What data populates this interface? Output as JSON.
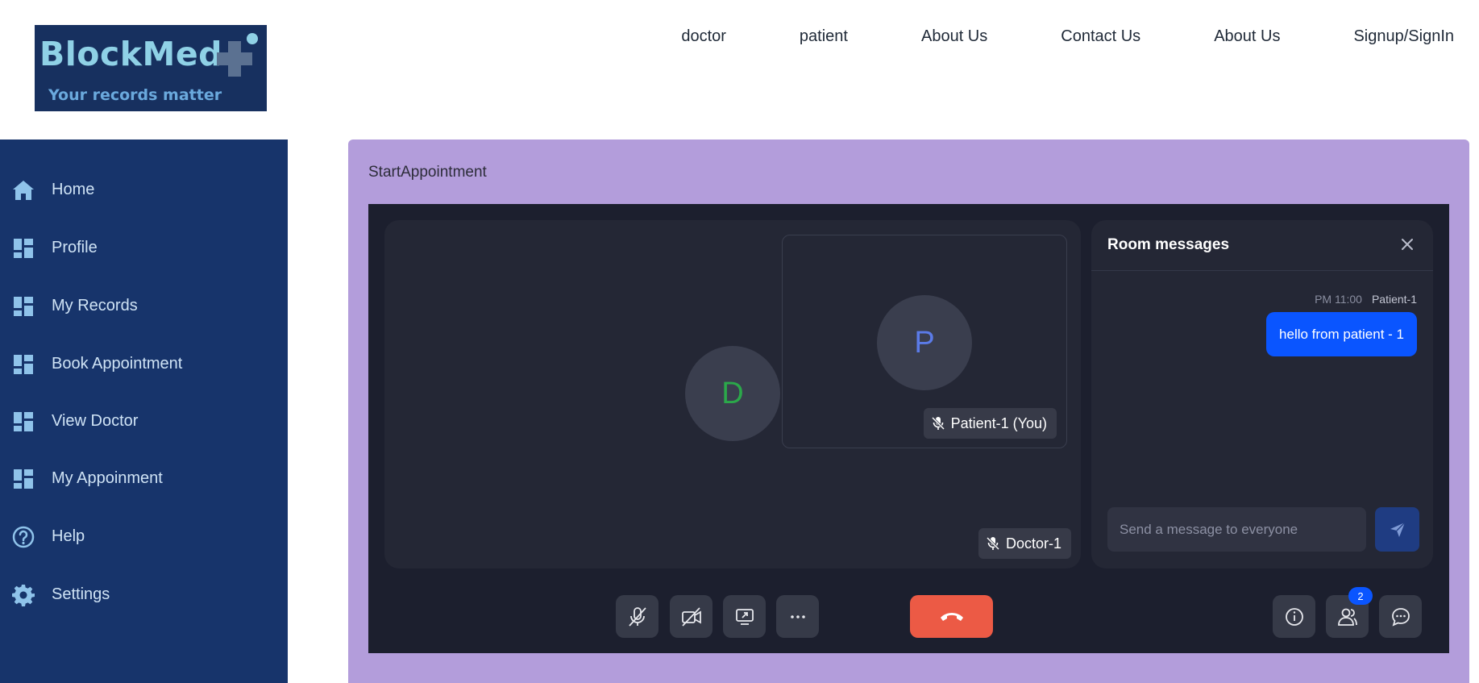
{
  "logo": {
    "title": "BlockMed",
    "tagline": "Your records matter"
  },
  "topnav": [
    "doctor",
    "patient",
    "About Us",
    "Contact Us",
    "About Us",
    "Signup/SignIn"
  ],
  "sidebar": {
    "items": [
      {
        "label": "Home",
        "icon": "home-icon"
      },
      {
        "label": "Profile",
        "icon": "dashboard-icon"
      },
      {
        "label": "My Records",
        "icon": "dashboard-icon"
      },
      {
        "label": "Book Appointment",
        "icon": "dashboard-icon"
      },
      {
        "label": "View Doctor",
        "icon": "dashboard-icon"
      },
      {
        "label": "My Appoinment",
        "icon": "dashboard-icon"
      },
      {
        "label": "Help",
        "icon": "help-icon"
      },
      {
        "label": "Settings",
        "icon": "gear-icon"
      }
    ]
  },
  "main": {
    "title": "StartAppointment"
  },
  "call": {
    "remote": {
      "initial": "D",
      "name": "Doctor-1"
    },
    "local": {
      "initial": "P",
      "name": "Patient-1 (You)"
    },
    "participants_count": "2",
    "chat": {
      "title": "Room messages",
      "messages": [
        {
          "time": "PM 11:00",
          "sender": "Patient-1",
          "text": "hello from patient - 1"
        }
      ],
      "input_placeholder": "Send a message to everyone"
    }
  },
  "colors": {
    "sidebar_bg": "#17346b",
    "panel_bg": "#b39ddb",
    "call_bg": "#1c1f2e",
    "hangup": "#ec5a45",
    "accent": "#0a55ff"
  }
}
